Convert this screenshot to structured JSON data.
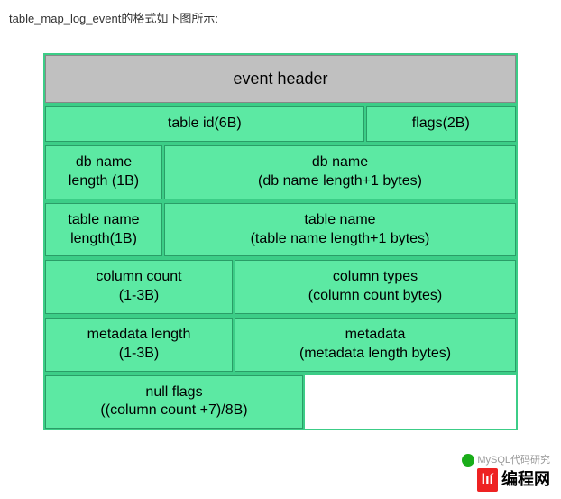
{
  "intro": "table_map_log_event的格式如下图所示:",
  "rows": {
    "r0c0": "event header",
    "r1c0": "table id(6B)",
    "r1c1": "flags(2B)",
    "r2c0": "db name\nlength (1B)",
    "r2c1": "db name\n(db name length+1 bytes)",
    "r3c0": "table name\nlength(1B)",
    "r3c1": "table name\n(table name length+1 bytes)",
    "r4c0": "column count\n(1-3B)",
    "r4c1": "column types\n(column count bytes)",
    "r5c0": "metadata length\n(1-3B)",
    "r5c1": "metadata\n(metadata length bytes)",
    "r6c0": "null flags\n((column count +7)/8B)"
  },
  "watermark": {
    "line1": "MySQL代码研究",
    "brand": "编程网"
  }
}
